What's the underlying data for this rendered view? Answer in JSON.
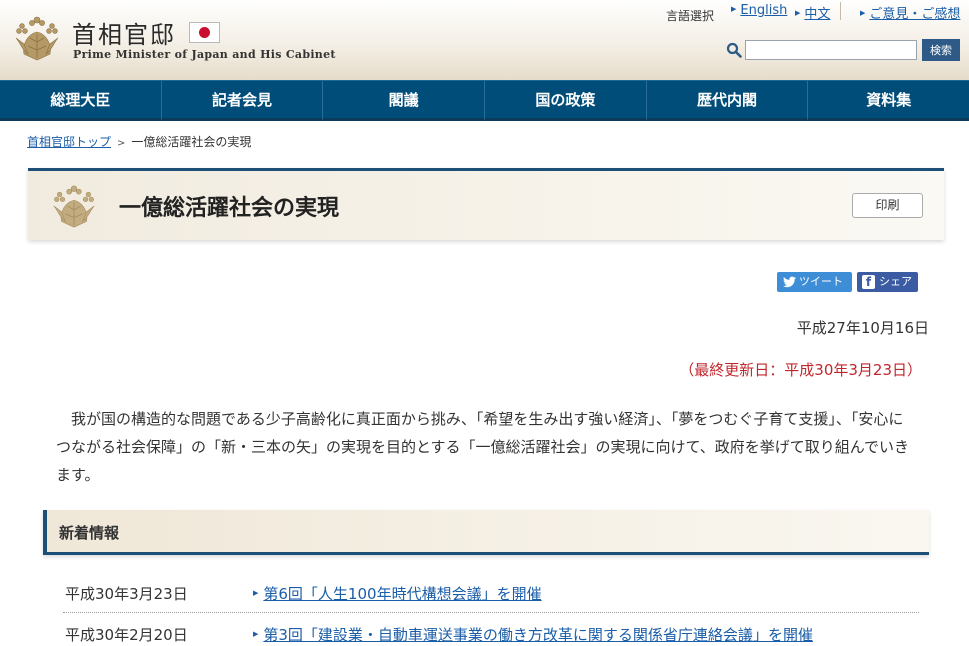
{
  "header": {
    "site_title": "首相官邸",
    "site_subtitle": "Prime Minister of Japan and His Cabinet",
    "language_label": "言語選択",
    "languages": [
      {
        "label": "English"
      },
      {
        "label": "中文"
      }
    ],
    "feedback_link": "ご意見・ご感想",
    "search": {
      "placeholder": "",
      "value": "",
      "button_label": "検索"
    }
  },
  "nav": {
    "items": [
      {
        "label": "総理大臣"
      },
      {
        "label": "記者会見"
      },
      {
        "label": "閣議"
      },
      {
        "label": "国の政策"
      },
      {
        "label": "歴代内閣"
      },
      {
        "label": "資料集"
      }
    ]
  },
  "breadcrumb": {
    "home": "首相官邸トップ",
    "separator": ">",
    "current": "一億総活躍社会の実現"
  },
  "page": {
    "title": "一億総活躍社会の実現",
    "print_label": "印刷",
    "tweet_label": "ツイート",
    "share_label": "シェア",
    "date": "平成27年10月16日",
    "updated": "（最終更新日：平成30年3月23日）",
    "intro": "我が国の構造的な問題である少子高齢化に真正面から挑み、「希望を生み出す強い経済」、「夢をつむぐ子育て支援」、「安心につながる社会保障」の「新・三本の矢」の実現を目的とする「一億総活躍社会」の実現に向けて、政府を挙げて取り組んでいきます。"
  },
  "news": {
    "heading": "新着情報",
    "items": [
      {
        "date": "平成30年3月23日",
        "title": "第6回「人生100年時代構想会議」を開催"
      },
      {
        "date": "平成30年2月20日",
        "title": "第3回「建設業・自動車運送事業の働き方改革に関する関係省庁連絡会議」を開催"
      }
    ]
  },
  "colors": {
    "nav_background": "#004d7a",
    "link": "#1a5da8",
    "updated_text": "#c0272d",
    "accent_border": "#1d4f77",
    "twitter": "#3d8ed6",
    "facebook": "#3b5ba3"
  },
  "icons": [
    "paulownia-crest-icon",
    "japan-flag-icon",
    "search-icon",
    "twitter-bird-icon",
    "facebook-icon"
  ]
}
